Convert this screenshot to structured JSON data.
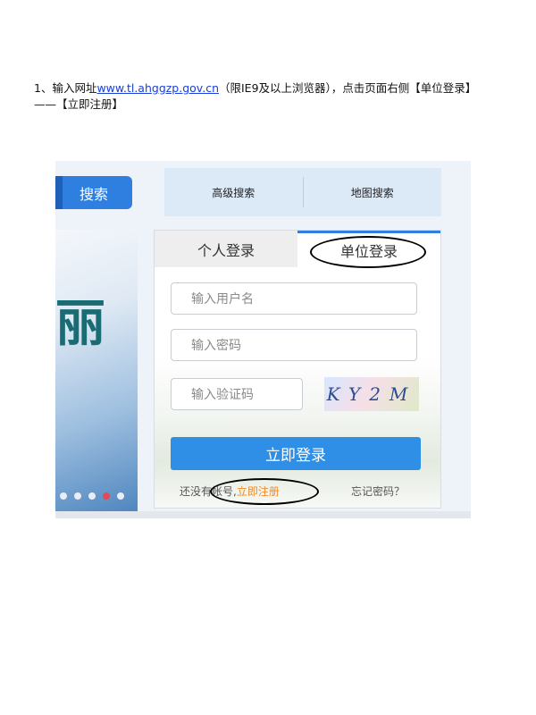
{
  "instruction": {
    "prefix": "1、输入网址",
    "url": "www.tl.ahggzp.gov.cn",
    "suffix": "（限IE9及以上浏览器），点击页面右侧【单位登录】——【立即注册】"
  },
  "screenshot": {
    "search_button": "搜索",
    "top_tabs": [
      "高级搜索",
      "地图搜索"
    ],
    "banner_char": "丽",
    "login_tabs": {
      "personal": "个人登录",
      "unit": "单位登录"
    },
    "fields": {
      "username_placeholder": "输入用户名",
      "password_placeholder": "输入密码",
      "captcha_placeholder": "输入验证码"
    },
    "captcha_text": "KY2M",
    "login_button": "立即登录",
    "no_account_text": "还没有帐号,",
    "register_link": "立即注册",
    "forgot_link": "忘记密码？"
  }
}
